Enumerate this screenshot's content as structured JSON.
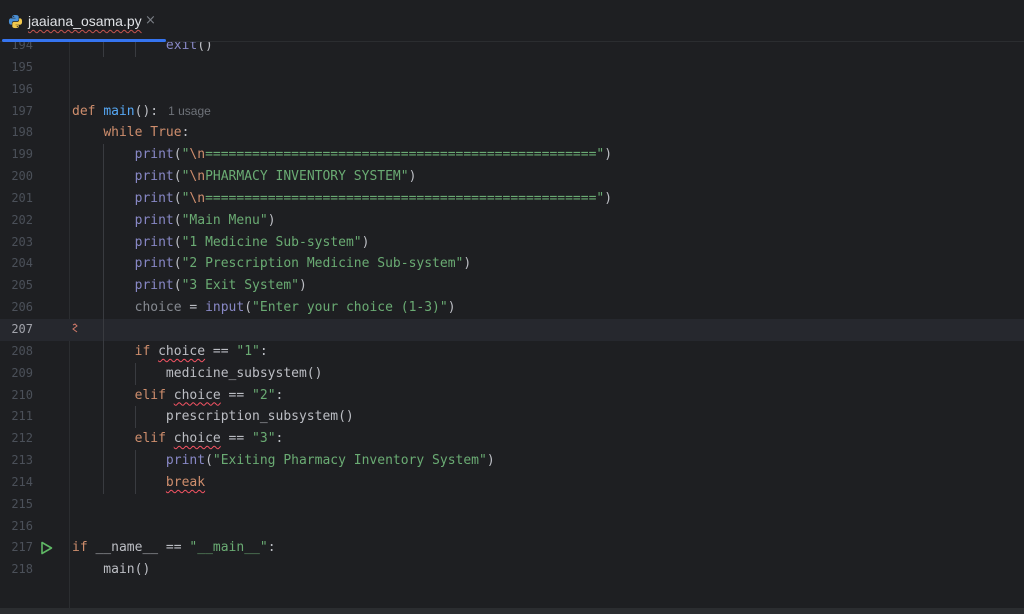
{
  "tab": {
    "filename": "jaaiana_osama.py",
    "close_glyph": "×"
  },
  "editor": {
    "usage_hint": "1 usage",
    "lines": [
      {
        "n": "194",
        "text": "            exit()"
      },
      {
        "n": "195",
        "text": ""
      },
      {
        "n": "196",
        "text": ""
      },
      {
        "n": "197",
        "text": "def main():"
      },
      {
        "n": "198",
        "text": "    while True:"
      },
      {
        "n": "199",
        "text": "        print(\"\\n==================================================\")"
      },
      {
        "n": "200",
        "text": "        print(\"\\nPHARMACY INVENTORY SYSTEM\")"
      },
      {
        "n": "201",
        "text": "        print(\"\\n==================================================\")"
      },
      {
        "n": "202",
        "text": "        print(\"Main Menu\")"
      },
      {
        "n": "203",
        "text": "        print(\"1 Medicine Sub-system\")"
      },
      {
        "n": "204",
        "text": "        print(\"2 Prescription Medicine Sub-system\")"
      },
      {
        "n": "205",
        "text": "        print(\"3 Exit System\")"
      },
      {
        "n": "206",
        "text": "        choice = input(\"Enter your choice (1-3)\")"
      },
      {
        "n": "207",
        "text": ""
      },
      {
        "n": "208",
        "text": "        if choice == \"1\":"
      },
      {
        "n": "209",
        "text": "            medicine_subsystem()"
      },
      {
        "n": "210",
        "text": "        elif choice == \"2\":"
      },
      {
        "n": "211",
        "text": "            prescription_subsystem()"
      },
      {
        "n": "212",
        "text": "        elif choice == \"3\":"
      },
      {
        "n": "213",
        "text": "            print(\"Exiting Pharmacy Inventory System\")"
      },
      {
        "n": "214",
        "text": "            break"
      },
      {
        "n": "215",
        "text": ""
      },
      {
        "n": "216",
        "text": ""
      },
      {
        "n": "217",
        "text": "if __name__ == \"__main__\":"
      },
      {
        "n": "218",
        "text": "    main()"
      }
    ],
    "current_line": "207"
  },
  "colors": {
    "background": "#1e1f22",
    "accent": "#3574f0",
    "keyword": "#cf8e6d",
    "function": "#56a8f5",
    "builtin": "#8888c6",
    "string": "#6aab73",
    "run_icon": "#5fb865"
  },
  "icons": {
    "file_type": "python-icon",
    "gutter_run": "run-icon"
  }
}
